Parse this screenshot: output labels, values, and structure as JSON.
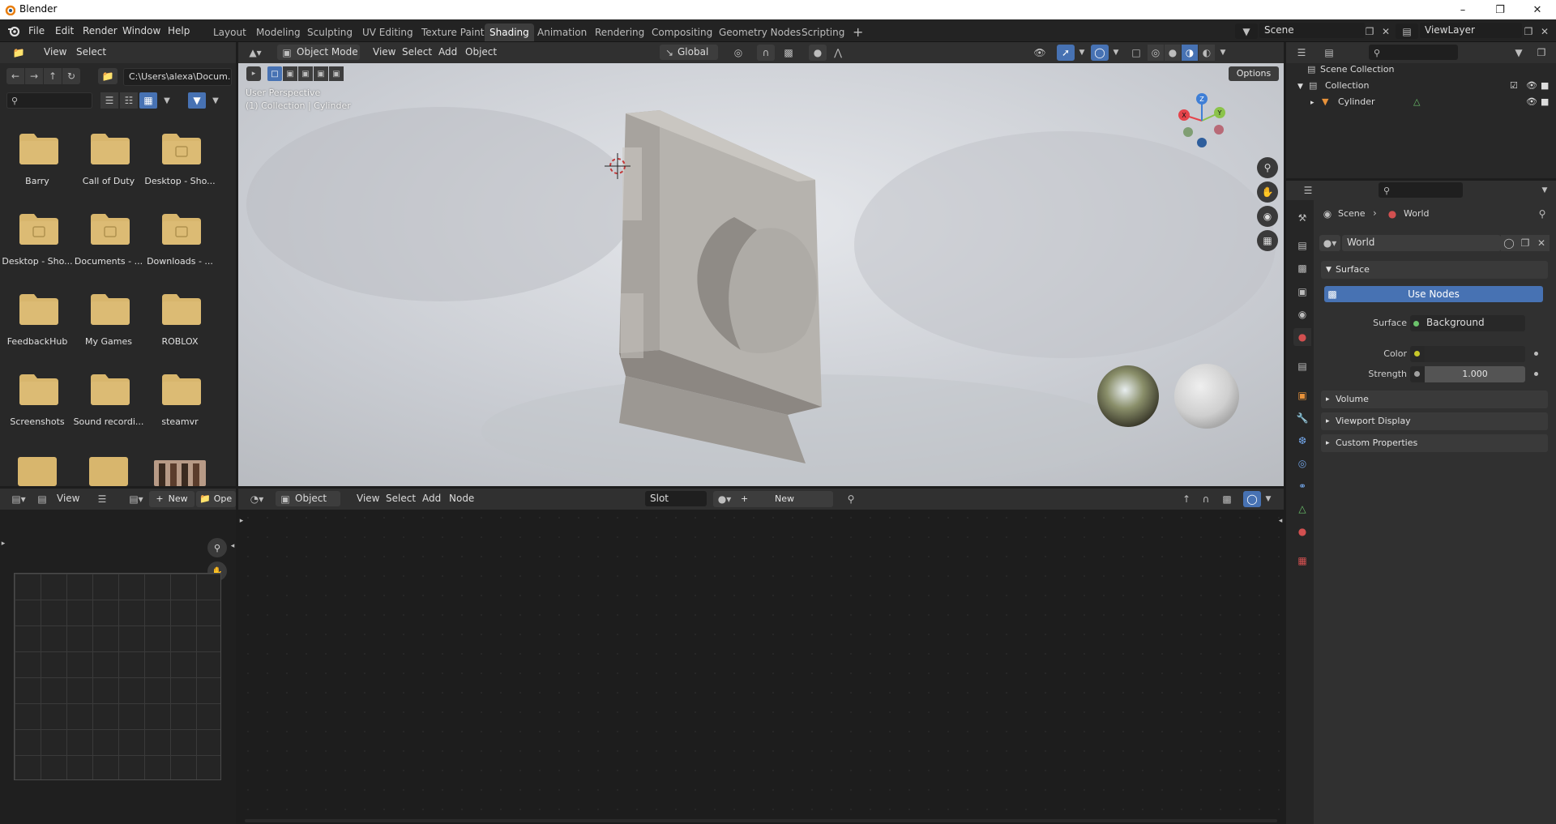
{
  "window": {
    "title": "Blender"
  },
  "menu": [
    "File",
    "Edit",
    "Render",
    "Window",
    "Help"
  ],
  "workspaces": [
    "Layout",
    "Modeling",
    "Sculpting",
    "UV Editing",
    "Texture Paint",
    "Shading",
    "Animation",
    "Rendering",
    "Compositing",
    "Geometry Nodes",
    "Scripting"
  ],
  "active_workspace": "Shading",
  "scene": {
    "name": "Scene",
    "view_layer": "ViewLayer"
  },
  "file_browser": {
    "menu": [
      "View",
      "Select"
    ],
    "path": "C:\\Users\\alexa\\Docum...",
    "folders": [
      "Barry",
      "Call of Duty",
      "Desktop - Sho...",
      "Desktop - Sho...",
      "Documents - ...",
      "Downloads - ...",
      "FeedbackHub",
      "My Games",
      "ROBLOX",
      "Screenshots",
      "Sound recordi...",
      "steamvr"
    ]
  },
  "viewport": {
    "mode": "Object Mode",
    "menu": [
      "View",
      "Select",
      "Add",
      "Object"
    ],
    "transform_orientation": "Global",
    "options_label": "Options",
    "overlay_line1": "User Perspective",
    "overlay_line2": "(1) Collection | Cylinder",
    "gizmo_axes": [
      "X",
      "Y",
      "Z"
    ]
  },
  "outliner": {
    "root": "Scene Collection",
    "collection": "Collection",
    "object": "Cylinder"
  },
  "properties": {
    "breadcrumb_scene": "Scene",
    "breadcrumb_world": "World",
    "world_name": "World",
    "surface_section": "Surface",
    "use_nodes_label": "Use Nodes",
    "surface_label": "Surface",
    "surface_value": "Background",
    "color_label": "Color",
    "strength_label": "Strength",
    "strength_value": "1.000",
    "sections": [
      "Volume",
      "Viewport Display",
      "Custom Properties"
    ]
  },
  "image_editor": {
    "view_label": "View",
    "new_label": "New",
    "open_label": "Ope"
  },
  "shader_editor": {
    "object_label": "Object",
    "menu": [
      "View",
      "Select",
      "Add",
      "Node"
    ],
    "slot_label": "Slot",
    "new_label": "New"
  },
  "colors": {
    "accent": "#4772b3",
    "active_tab": "#3d3d3d",
    "folder": "#d8b66d",
    "axis_x": "#e5434a",
    "axis_y": "#8bc34a",
    "axis_z": "#3f7fd6"
  }
}
